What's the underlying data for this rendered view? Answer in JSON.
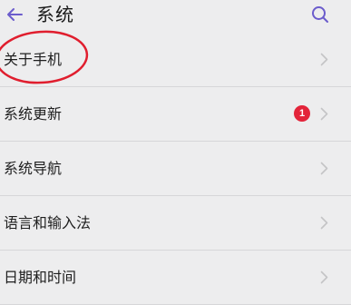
{
  "header": {
    "title": "系统",
    "back_icon": "arrow-left-icon",
    "search_icon": "search-icon",
    "accent_color": "#6b5ccc"
  },
  "list": {
    "items": [
      {
        "label": "关于手机",
        "icon": "chevron-right-icon",
        "highlighted": true
      },
      {
        "label": "系统更新",
        "icon": "chevron-right-icon",
        "badge": "1",
        "badge_color": "#e3243a"
      },
      {
        "label": "系统导航",
        "icon": "chevron-right-icon"
      },
      {
        "label": "语言和输入法",
        "icon": "chevron-right-icon"
      },
      {
        "label": "日期和时间",
        "icon": "chevron-right-icon"
      }
    ]
  },
  "annotation": {
    "color": "#e01e2e",
    "target": "关于手机"
  }
}
